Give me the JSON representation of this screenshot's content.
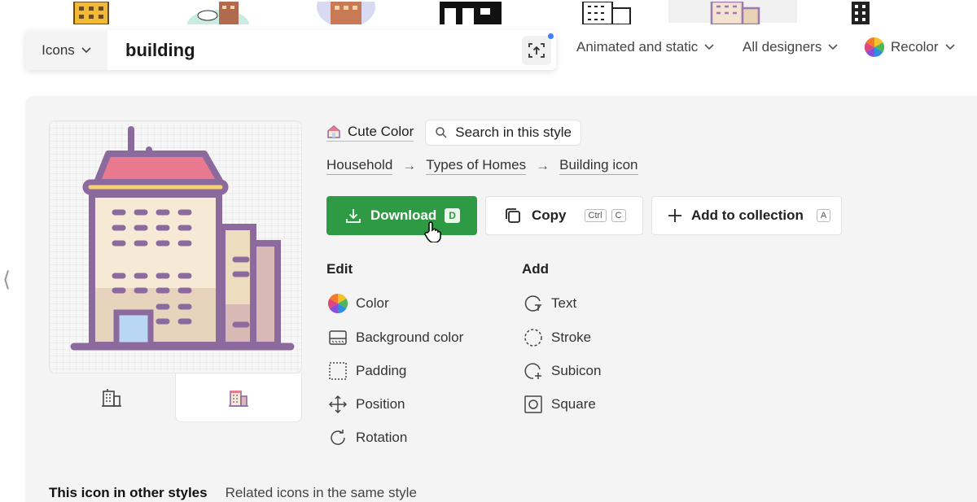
{
  "search": {
    "type_label": "Icons",
    "query": "building"
  },
  "filters": {
    "animation": "Animated and static",
    "designers": "All designers",
    "recolor": "Recolor"
  },
  "style": {
    "name": "Cute Color",
    "search_label": "Search in this style"
  },
  "breadcrumb": [
    "Household",
    "Types of Homes",
    "Building icon"
  ],
  "actions": {
    "download": {
      "label": "Download",
      "shortcut": "D"
    },
    "copy": {
      "label": "Copy",
      "shortcut_mod": "Ctrl",
      "shortcut_key": "C"
    },
    "add": {
      "label": "Add to collection",
      "shortcut": "A"
    }
  },
  "edit": {
    "title": "Edit",
    "items": [
      "Color",
      "Background color",
      "Padding",
      "Position",
      "Rotation"
    ]
  },
  "add": {
    "title": "Add",
    "items": [
      "Text",
      "Stroke",
      "Subicon",
      "Square"
    ]
  },
  "bottom_tabs": [
    "This icon in other styles",
    "Related icons in the same style"
  ],
  "colors": {
    "download_green": "#2e9a44",
    "building_purple": "#8c6a9e",
    "roof_pink": "#e0607a",
    "wall_cream": "#f6ead6"
  }
}
